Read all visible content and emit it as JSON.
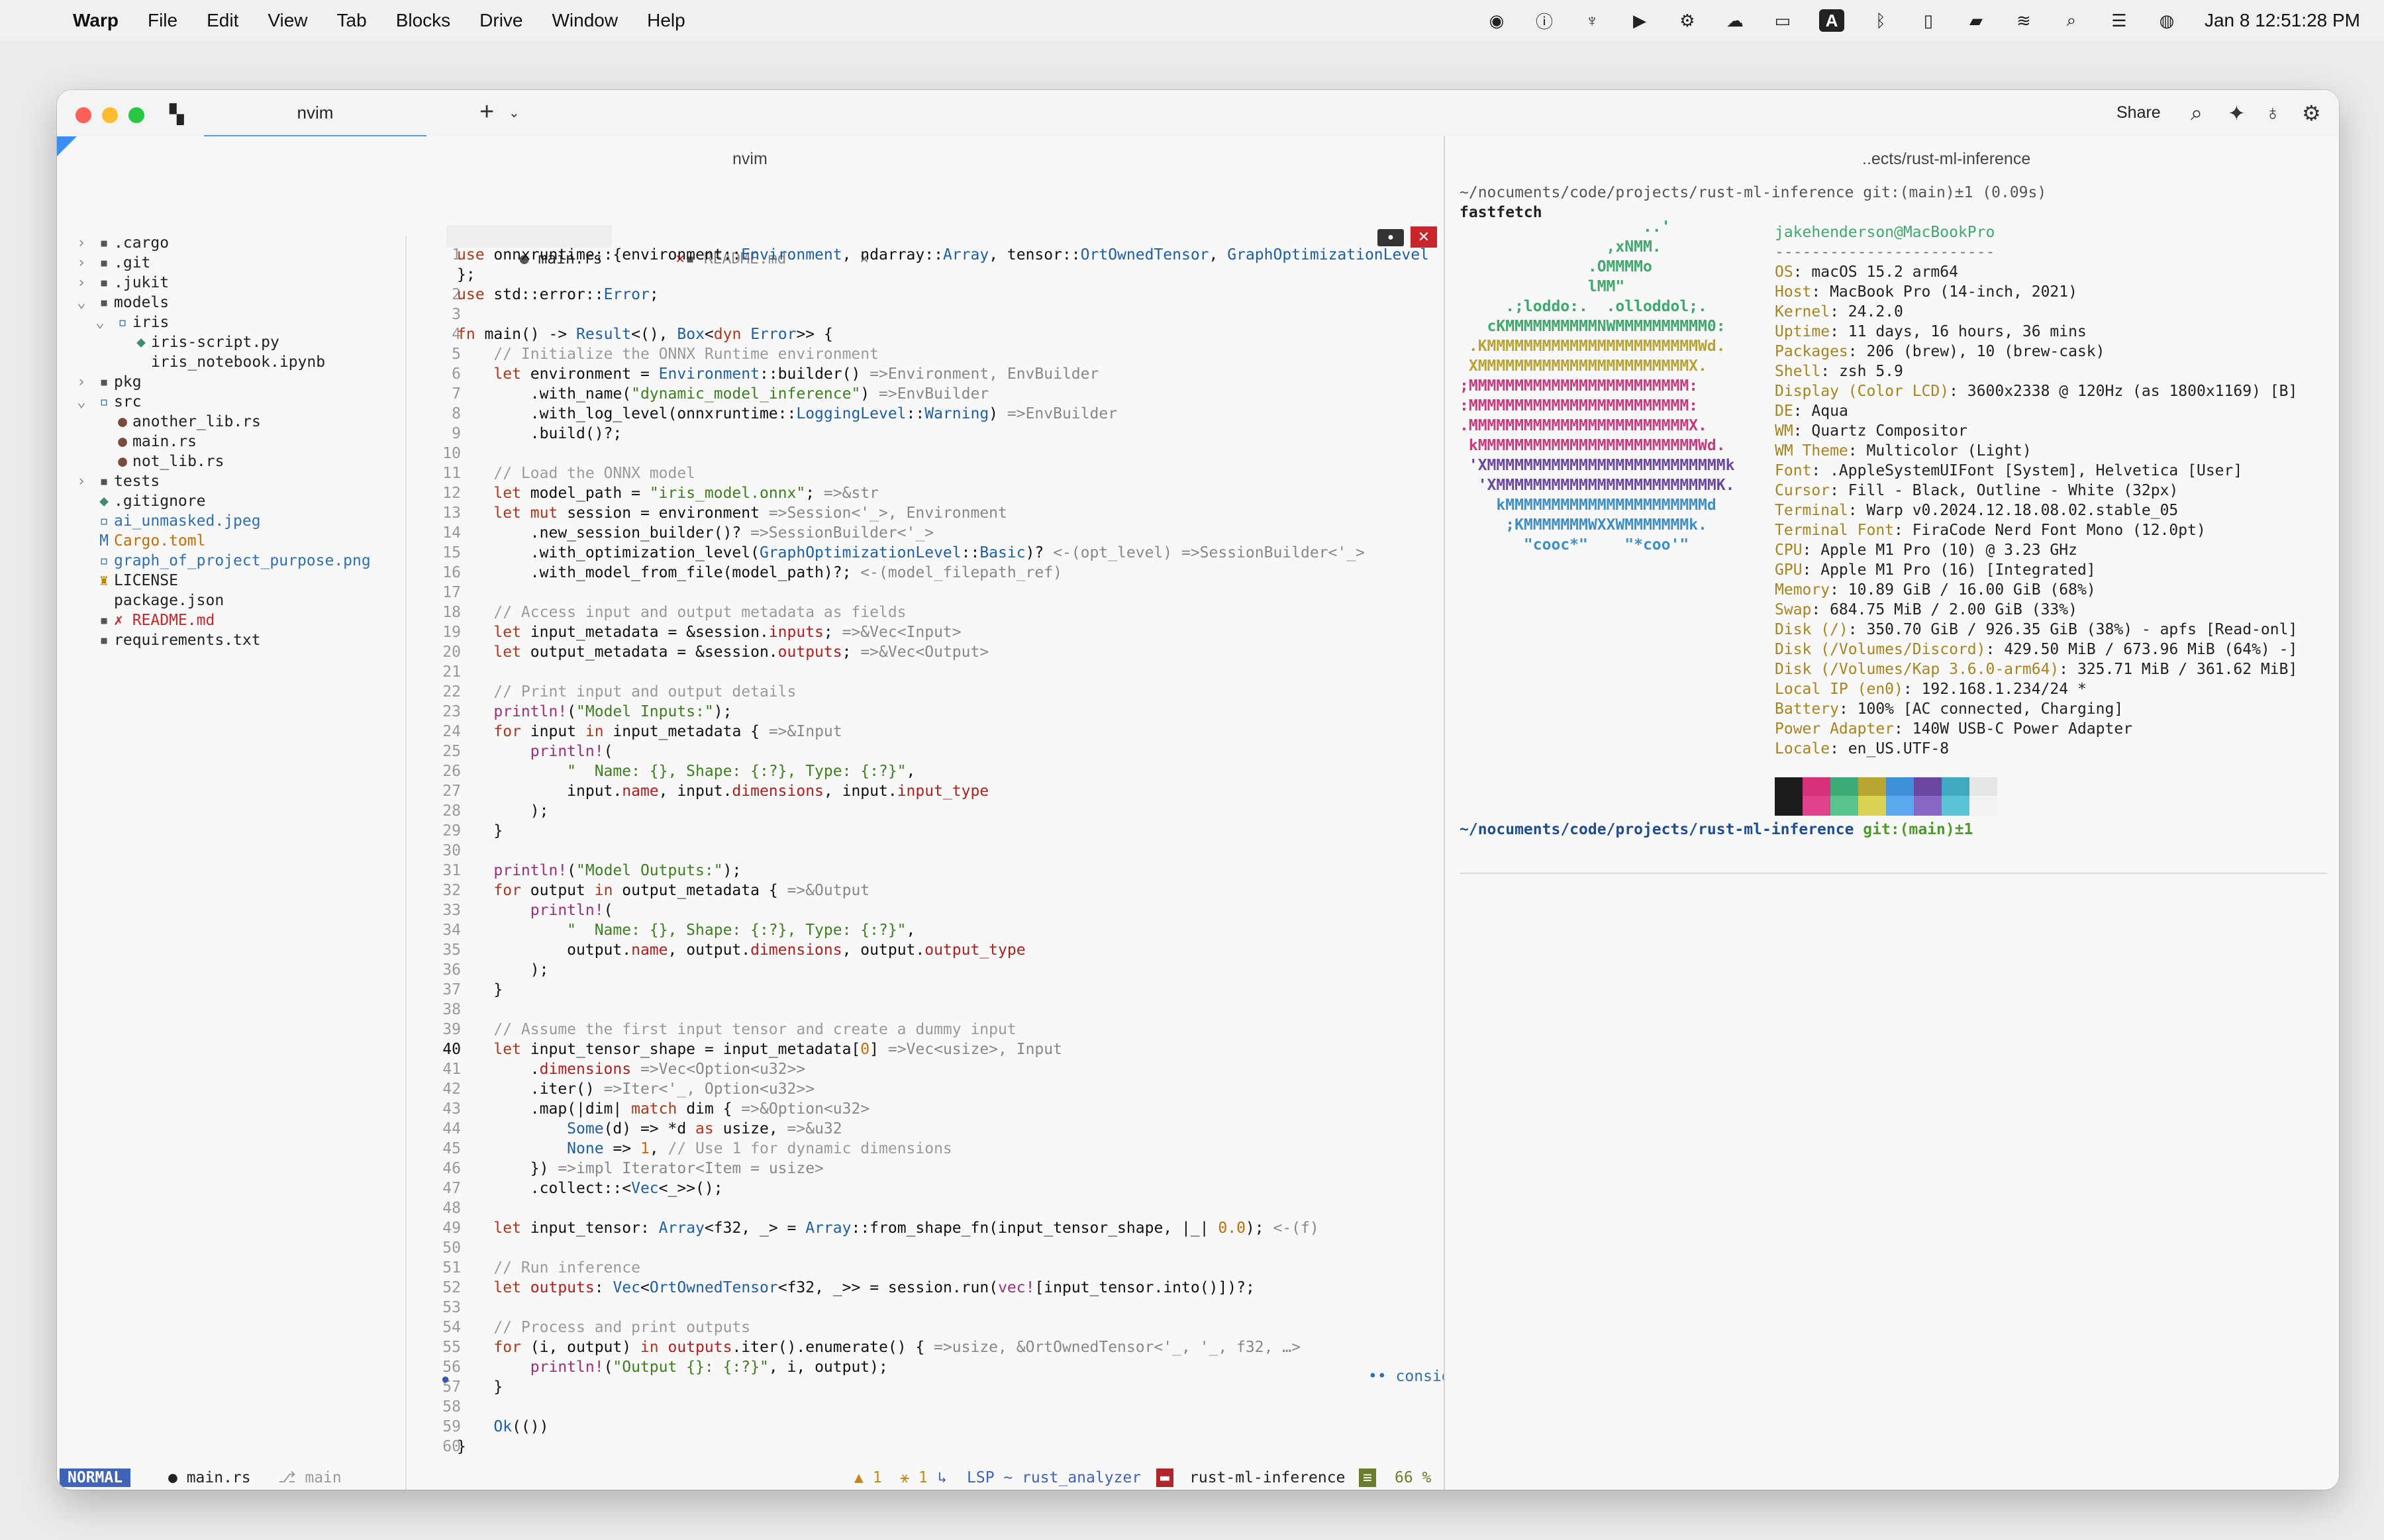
{
  "menubar": {
    "app": "Warp",
    "items": [
      "File",
      "Edit",
      "View",
      "Tab",
      "Blocks",
      "Drive",
      "Window",
      "Help"
    ],
    "status_icons": [
      "creative-cloud-icon",
      "accessibility-icon",
      "dj-icon",
      "play-icon",
      "gear-icon",
      "weather-icon",
      "display-icon",
      "A",
      "bluetooth-icon",
      "window-icon",
      "battery-icon",
      "wifi-icon",
      "search-icon",
      "control-center-icon",
      "siri-icon"
    ],
    "input_badge": "A",
    "clock": "Jan 8  12:51:28 PM"
  },
  "window": {
    "tab_title": "nvim",
    "share": "Share",
    "left_pane_title": "nvim",
    "right_pane_title": "..ects/rust-ml-inference"
  },
  "tree": [
    {
      "chev": "›",
      "icon": "▪",
      "label": ".cargo",
      "depth": 0
    },
    {
      "chev": "›",
      "icon": "▪",
      "label": ".git",
      "depth": 0
    },
    {
      "chev": "›",
      "icon": "▪",
      "label": ".jukit",
      "depth": 0
    },
    {
      "chev": "⌄",
      "icon": "▪",
      "label": "models",
      "depth": 0
    },
    {
      "chev": "⌄",
      "icon": "▫",
      "label": "iris",
      "depth": 1
    },
    {
      "chev": "",
      "icon": "◆",
      "label": "iris-script.py",
      "depth": 2
    },
    {
      "chev": "",
      "icon": "",
      "label": "iris_notebook.ipynb",
      "depth": 2
    },
    {
      "chev": "›",
      "icon": "▪",
      "label": "pkg",
      "depth": 0
    },
    {
      "chev": "⌄",
      "icon": "▫",
      "label": "src",
      "depth": 0
    },
    {
      "chev": "",
      "icon": "●",
      "label": "another_lib.rs",
      "depth": 1
    },
    {
      "chev": "",
      "icon": "●",
      "label": "main.rs",
      "depth": 1
    },
    {
      "chev": "",
      "icon": "●",
      "label": "not_lib.rs",
      "depth": 1
    },
    {
      "chev": "›",
      "icon": "▪",
      "label": "tests",
      "depth": 0
    },
    {
      "chev": "",
      "icon": "◆",
      "label": ".gitignore",
      "depth": 0
    },
    {
      "chev": "",
      "icon": "▫",
      "label": "ai_unmasked.jpeg",
      "depth": 0
    },
    {
      "chev": "",
      "icon": "M",
      "label": "Cargo.toml",
      "depth": 0
    },
    {
      "chev": "",
      "icon": "▫",
      "label": "graph_of_project_purpose.png",
      "depth": 0
    },
    {
      "chev": "",
      "icon": "♜",
      "label": "LICENSE",
      "depth": 0
    },
    {
      "chev": "",
      "icon": "",
      "label": "package.json",
      "depth": 0
    },
    {
      "chev": "",
      "icon": "▪",
      "label": "✗ README.md",
      "depth": 0
    },
    {
      "chev": "",
      "icon": "▪",
      "label": "requirements.txt",
      "depth": 0
    }
  ],
  "buffers": {
    "active": "main.rs",
    "inactive": "README.md",
    "close": "×"
  },
  "line_numbers": [
    "1",
    "",
    "2",
    "3",
    "4",
    "5",
    "6",
    "7",
    "8",
    "9",
    "10",
    "11",
    "12",
    "13",
    "14",
    "15",
    "16",
    "17",
    "18",
    "19",
    "20",
    "21",
    "22",
    "23",
    "24",
    "25",
    "26",
    "27",
    "28",
    "29",
    "30",
    "31",
    "32",
    "33",
    "34",
    "35",
    "36",
    "37",
    "38",
    "39",
    "40",
    "41",
    "42",
    "43",
    "44",
    "45",
    "46",
    "47",
    "48",
    "49",
    "50",
    "51",
    "52",
    "53",
    "54",
    "55",
    "56",
    "57",
    "58",
    "59",
    "60"
  ],
  "code_lines": [
    "use onnxruntime::{environment::Environment, ndarray::Array, tensor::OrtOwnedTensor, GraphOptimizationLevel",
    "};",
    "use std::error::Error;",
    "",
    "fn main() -> Result<(), Box<dyn Error>> {",
    "    // Initialize the ONNX Runtime environment",
    "    let environment = Environment::builder() =>Environment, EnvBuilder",
    "        .with_name(\"dynamic_model_inference\") =>EnvBuilder",
    "        .with_log_level(onnxruntime::LoggingLevel::Warning) =>EnvBuilder",
    "        .build()?;",
    "",
    "    // Load the ONNX model",
    "    let model_path = \"iris_model.onnx\"; =>&str",
    "    let mut session = environment =>Session<'_>, Environment",
    "        .new_session_builder()? =>SessionBuilder<'_>",
    "        .with_optimization_level(GraphOptimizationLevel::Basic)? <-(opt_level) =>SessionBuilder<'_>",
    "        .with_model_from_file(model_path)?; <-(model_filepath_ref)",
    "",
    "    // Access input and output metadata as fields",
    "    let input_metadata = &session.inputs; =>&Vec<Input>",
    "    let output_metadata = &session.outputs; =>&Vec<Output>",
    "",
    "    // Print input and output details",
    "    println!(\"Model Inputs:\");",
    "    for input in input_metadata { =>&Input",
    "        println!(",
    "            \"  Name: {}, Shape: {:?}, Type: {:?}\",",
    "            input.name, input.dimensions, input.input_type",
    "        );",
    "    }",
    "",
    "    println!(\"Model Outputs:\");",
    "    for output in output_metadata { =>&Output",
    "        println!(",
    "            \"  Name: {}, Shape: {:?}, Type: {:?}\",",
    "            output.name, output.dimensions, output.output_type",
    "        );",
    "    }",
    "",
    "    // Assume the first input tensor and create a dummy input",
    "    let input_tensor_shape = input_metadata[0] =>Vec<usize>, Input",
    "        .dimensions =>Vec<Option<u32>>",
    "        .iter() =>Iter<'_, Option<u32>>",
    "        .map(|dim| match dim { =>&Option<u32>",
    "            Some(d) => *d as usize, =>&u32",
    "            None => 1, // Use 1 for dynamic dimensions",
    "        }) =>impl Iterator<Item = usize>",
    "        .collect::<Vec<_>>();",
    "",
    "    let input_tensor: Array<f32, _> = Array::from_shape_fn(input_tensor_shape, |_| 0.0); <-(f)",
    "",
    "    // Run inference",
    "    let outputs: Vec<OrtOwnedTensor<f32, _>> = session.run(vec![input_tensor.into()])?;",
    "",
    "    // Process and print outputs",
    "    for (i, output) in outputs.iter().enumerate() { =>usize, &OrtOwnedTensor<'_, '_, f32, …>",
    "        println!(\"Output {}: {:?}\", i, output);",
    "    }",
    "",
    "    Ok(())",
    "}"
  ],
  "diagnostic_hint": "•• consider re",
  "statusline": {
    "mode": "NORMAL",
    "file": "● main.rs",
    "branch": "⎇ main",
    "diagnostics": "▲ 1  ⚹ 1",
    "lsp": "LSP ~ rust_analyzer",
    "project": "rust-ml-inference",
    "percent": "66 %"
  },
  "terminal": {
    "prompt1": "~/nocuments/code/projects/rust-ml-inference git:(main)±1 (0.09s)",
    "command": "fastfetch",
    "user_host": "jakehenderson@MacBookPro",
    "separator": "------------------------",
    "logo": [
      "                    ..'",
      "                ,xNMM.",
      "              .OMMMMo",
      "              lMM\"",
      "     .;loddo:.  .olloddol;.",
      "   cKMMMMMMMMMMNWMMMMMMMMMM0:",
      " .KMMMMMMMMMMMMMMMMMMMMMMMWd.",
      " XMMMMMMMMMMMMMMMMMMMMMMMX.",
      ";MMMMMMMMMMMMMMMMMMMMMMMM:",
      ":MMMMMMMMMMMMMMMMMMMMMMMM:",
      ".MMMMMMMMMMMMMMMMMMMMMMMMX.",
      " kMMMMMMMMMMMMMMMMMMMMMMMMWd.",
      " 'XMMMMMMMMMMMMMMMMMMMMMMMMMMk",
      "  'XMMMMMMMMMMMMMMMMMMMMMMMMK.",
      "    kMMMMMMMMMMMMMMMMMMMMMMd",
      "     ;KMMMMMMMWXXWMMMMMMMk.",
      "       \"cooc*\"    \"*coo'\""
    ],
    "info": [
      {
        "k": "OS",
        "v": ": macOS 15.2 arm64"
      },
      {
        "k": "Host",
        "v": ": MacBook Pro (14-inch, 2021)"
      },
      {
        "k": "Kernel",
        "v": ": 24.2.0"
      },
      {
        "k": "Uptime",
        "v": ": 11 days, 16 hours, 36 mins"
      },
      {
        "k": "Packages",
        "v": ": 206 (brew), 10 (brew-cask)"
      },
      {
        "k": "Shell",
        "v": ": zsh 5.9"
      },
      {
        "k": "Display (Color LCD)",
        "v": ": 3600x2338 @ 120Hz (as 1800x1169) [B]"
      },
      {
        "k": "DE",
        "v": ": Aqua"
      },
      {
        "k": "WM",
        "v": ": Quartz Compositor"
      },
      {
        "k": "WM Theme",
        "v": ": Multicolor (Light)"
      },
      {
        "k": "Font",
        "v": ": .AppleSystemUIFont [System], Helvetica [User]"
      },
      {
        "k": "Cursor",
        "v": ": Fill - Black, Outline - White (32px)"
      },
      {
        "k": "Terminal",
        "v": ": Warp v0.2024.12.18.08.02.stable_05"
      },
      {
        "k": "Terminal Font",
        "v": ": FiraCode Nerd Font Mono (12.0pt)"
      },
      {
        "k": "CPU",
        "v": ": Apple M1 Pro (10) @ 3.23 GHz"
      },
      {
        "k": "GPU",
        "v": ": Apple M1 Pro (16) [Integrated]"
      },
      {
        "k": "Memory",
        "v": ": 10.89 GiB / 16.00 GiB (68%)"
      },
      {
        "k": "Swap",
        "v": ": 684.75 MiB / 2.00 GiB (33%)"
      },
      {
        "k": "Disk (/)",
        "v": ": 350.70 GiB / 926.35 GiB (38%) - apfs [Read-onl]"
      },
      {
        "k": "Disk (/Volumes/Discord)",
        "v": ": 429.50 MiB / 673.96 MiB (64%) -]"
      },
      {
        "k": "Disk (/Volumes/Kap 3.6.0-arm64)",
        "v": ": 325.71 MiB / 361.62 MiB]"
      },
      {
        "k": "Local IP (en0)",
        "v": ": 192.168.1.234/24 *"
      },
      {
        "k": "Battery",
        "v": ": 100% [AC connected, Charging]"
      },
      {
        "k": "Power Adapter",
        "v": ": 140W USB-C Power Adapter"
      },
      {
        "k": "Locale",
        "v": ": en_US.UTF-8"
      }
    ],
    "swatches": [
      "#1d1d1d",
      "#d7307b",
      "#3daa7a",
      "#b8a432",
      "#3d8fd8",
      "#6a46a0",
      "#3ea9c0",
      "#e6e6e6"
    ],
    "swatches_bottom": [
      "#1d1d1d",
      "#e0418d",
      "#59c58e",
      "#dbd352",
      "#5aa8ee",
      "#8a66c4",
      "#5cc3d6",
      "#f2f2f2"
    ],
    "prompt2": "~/nocuments/code/projects/rust-ml-inference",
    "prompt2_git": "git:(main)±1"
  },
  "colors": {
    "accent_blue": "#3e63b8",
    "tab_underline": "#4ea1e8",
    "label_gold": "#a8841e",
    "prompt_blue": "#1d4e8f",
    "prompt_green": "#4e9a2a"
  }
}
